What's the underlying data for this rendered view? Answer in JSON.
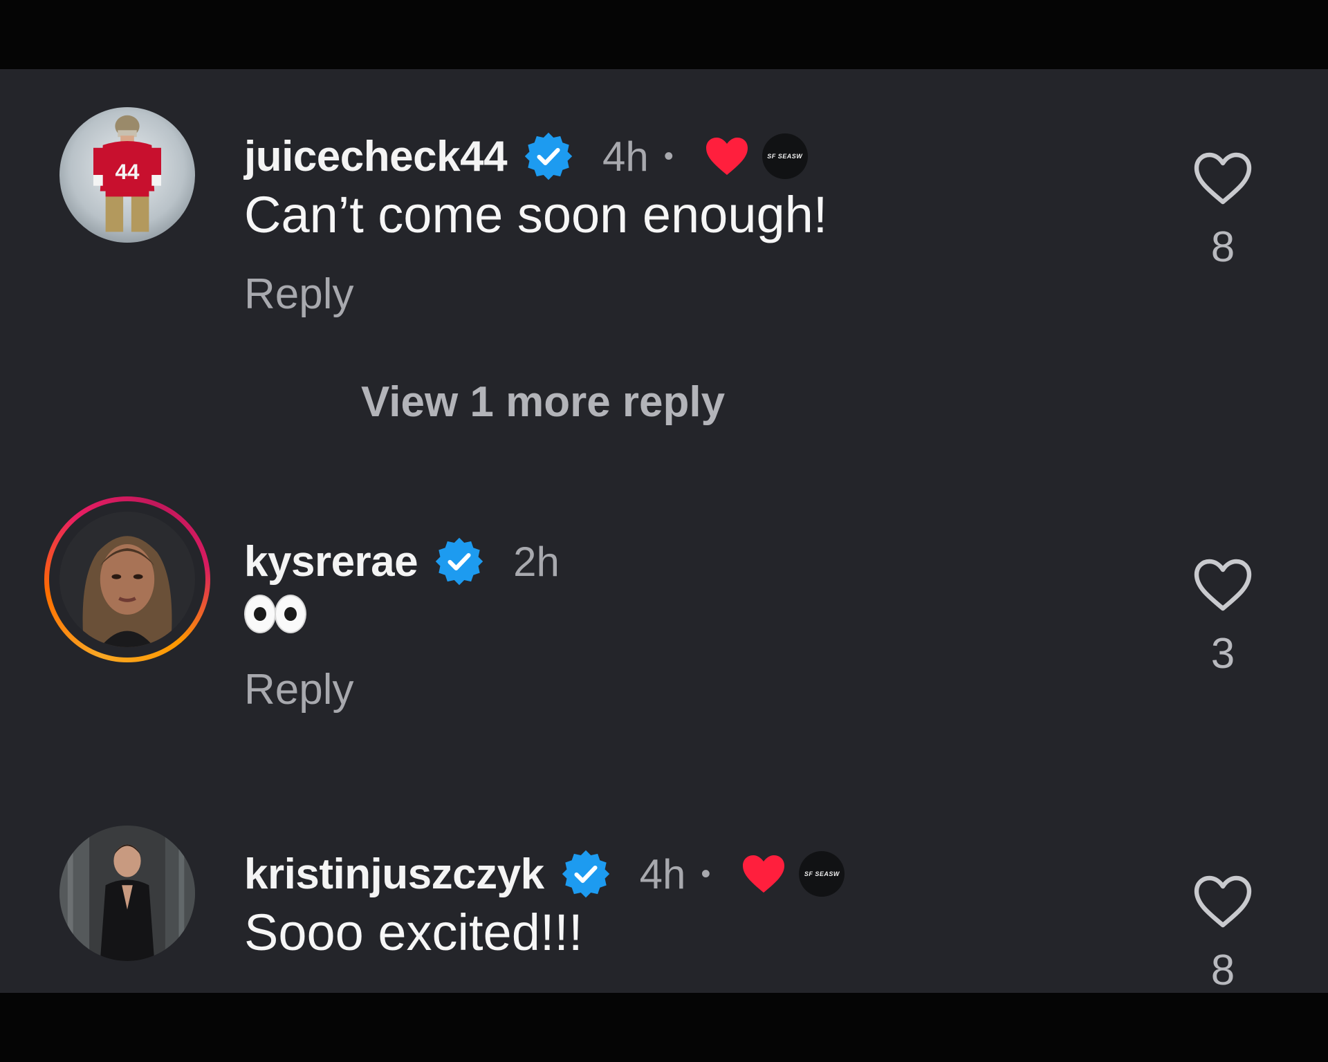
{
  "colors": {
    "background": "#24252a",
    "letterbox": "#050505",
    "verified_blue": "#1d9bf0",
    "liked_red": "#ff1f3d",
    "muted_text": "#a8a9ae"
  },
  "view_more_replies": "View 1 more reply",
  "comments": [
    {
      "username": "juicecheck44",
      "verified": true,
      "time": "4h",
      "separator": "•",
      "liked_by_creator": true,
      "creator_badge": "SF SEASW",
      "text": "Can’t come soon enough!",
      "reply_label": "Reply",
      "like_count": "8",
      "avatar_icon": "football-player-avatar"
    },
    {
      "username": "kysrerae",
      "verified": true,
      "time": "2h",
      "has_story_ring": true,
      "text_emoji": "eyes-emoji",
      "reply_label": "Reply",
      "like_count": "3",
      "avatar_icon": "woman-portrait-avatar"
    },
    {
      "username": "kristinjuszczyk",
      "verified": true,
      "time": "4h",
      "separator": "•",
      "liked_by_creator": true,
      "creator_badge": "SF SEASW",
      "text": "Sooo excited!!!",
      "like_count": "8",
      "avatar_icon": "woman-black-suit-avatar"
    }
  ]
}
